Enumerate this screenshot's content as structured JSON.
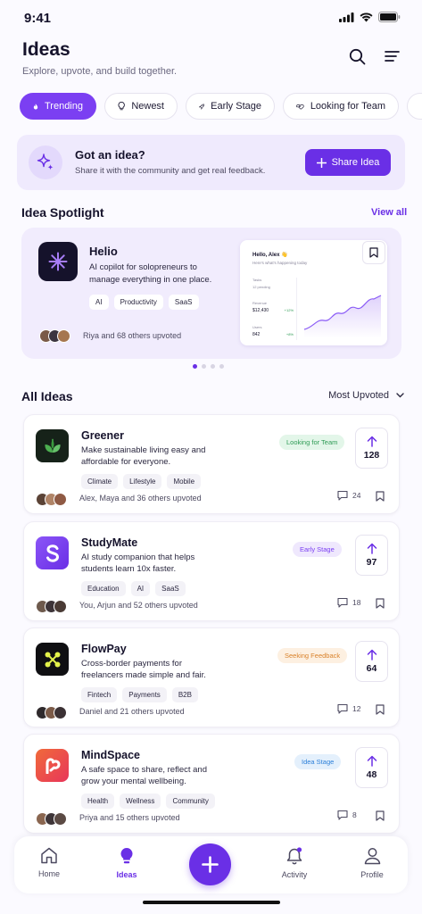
{
  "status": {
    "time": "9:41"
  },
  "header": {
    "title": "Ideas",
    "subtitle": "Explore, upvote, and build together."
  },
  "chips": [
    {
      "label": "Trending",
      "icon": "flame-icon",
      "active": true
    },
    {
      "label": "Newest",
      "icon": "bulb-icon"
    },
    {
      "label": "Early Stage",
      "icon": "rocket-icon"
    },
    {
      "label": "Looking for Team",
      "icon": "handshake-icon"
    }
  ],
  "banner": {
    "title": "Got an idea?",
    "subtitle": "Share it with the community and get real feedback.",
    "button": "Share Idea"
  },
  "spotlight": {
    "section_title": "Idea Spotlight",
    "view_all": "View all",
    "name": "Helio",
    "description": "AI copilot for solopreneurs to manage everything in one place.",
    "tags": [
      "AI",
      "Productivity",
      "SaaS"
    ],
    "upvoted": "Riya and 68 others upvoted",
    "preview": {
      "greeting": "Hello, Alex 👋",
      "sub": "Here's what's happening today",
      "rows": [
        {
          "label": "Tasks",
          "value": "12 pending"
        },
        {
          "label": "Revenue",
          "value": "$12,430",
          "delta": "+12%"
        },
        {
          "label": "Users",
          "value": "842",
          "delta": "+8%"
        }
      ]
    }
  },
  "all_ideas": {
    "section_title": "All Ideas",
    "sort_label": "Most Upvoted",
    "items": [
      {
        "name": "Greener",
        "description": "Make sustainable living easy and affordable for everyone.",
        "tags": [
          "Climate",
          "Lifestyle",
          "Mobile"
        ],
        "badge": "Looking for Team",
        "badge_color": "#2e9b55",
        "badge_bg": "#e3f6e9",
        "votes": "128",
        "upvoted": "Alex, Maya and 36 others upvoted",
        "comments": "24",
        "logo_bg": "#162219",
        "logo": "leaf-icon"
      },
      {
        "name": "StudyMate",
        "description": "AI study companion that helps students learn 10x faster.",
        "tags": [
          "Education",
          "AI",
          "SaaS"
        ],
        "badge": "Early Stage",
        "badge_color": "#7b3ff2",
        "badge_bg": "#efe8fd",
        "votes": "97",
        "upvoted": "You, Arjun and 52 others upvoted",
        "comments": "18",
        "logo_bg": "#7b3ff2",
        "logo": "letter-s-icon"
      },
      {
        "name": "FlowPay",
        "description": "Cross-border payments for freelancers made simple and fair.",
        "tags": [
          "Fintech",
          "Payments",
          "B2B"
        ],
        "badge": "Seeking Feedback",
        "badge_color": "#d9822b",
        "badge_bg": "#fdf0e1",
        "votes": "64",
        "upvoted": "Daniel and 21 others upvoted",
        "comments": "12",
        "logo_bg": "#0f0f12",
        "logo": "network-icon"
      },
      {
        "name": "MindSpace",
        "description": "A safe space to share, reflect and grow your mental wellbeing.",
        "tags": [
          "Health",
          "Wellness",
          "Community"
        ],
        "badge": "Idea Stage",
        "badge_color": "#2b7fd9",
        "badge_bg": "#e4f0fc",
        "votes": "48",
        "upvoted": "Priya and 15 others upvoted",
        "comments": "8",
        "logo_bg": "#f0503c",
        "logo": "mind-icon"
      }
    ]
  },
  "tabbar": {
    "home": "Home",
    "ideas": "Ideas",
    "activity": "Activity",
    "profile": "Profile"
  },
  "colors": {
    "accent": "#6a2fe6",
    "text": "#15122b"
  }
}
